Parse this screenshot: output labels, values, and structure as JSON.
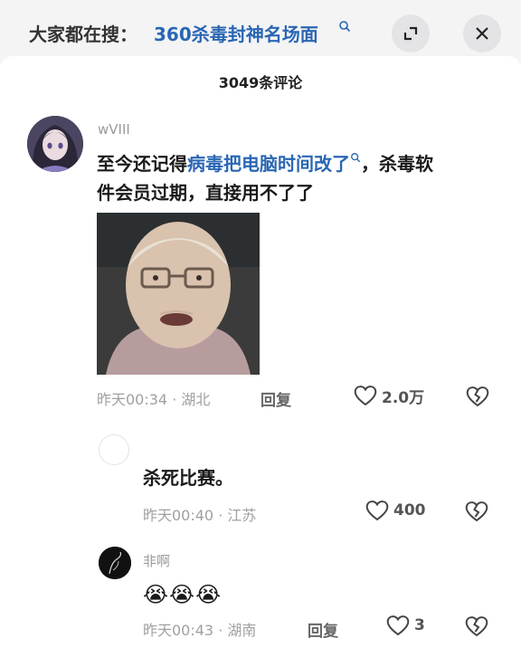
{
  "search": {
    "prefix": "大家都在搜：",
    "term": "360杀毒封神名场面"
  },
  "header": {
    "comment_count": "3049条评论"
  },
  "comments": [
    {
      "user": "wVIII",
      "text_part1": "至今还记得",
      "text_link": "病毒把电脑时间改了",
      "text_part2": "，杀毒软",
      "text_line2": "件会员过期，直接用不了了",
      "time": "昨天00:34 · 湖北",
      "reply": "回复",
      "likes": "2.0万"
    },
    {
      "user": "",
      "text": "杀死比赛。",
      "time": "昨天00:40 · 江苏",
      "likes": "400"
    },
    {
      "user": "非啊",
      "text": "😭😭😭",
      "time": "昨天00:43 · 湖南",
      "reply": "回复",
      "likes": "3"
    }
  ],
  "icons": {
    "expand": "expand-icon",
    "close": "close-icon",
    "like": "heart-icon",
    "dislike": "broken-heart-icon",
    "search": "search-icon"
  },
  "colors": {
    "link": "#2a66b3",
    "meta": "#a0a0a0",
    "topbar": "#f4f4f5"
  }
}
